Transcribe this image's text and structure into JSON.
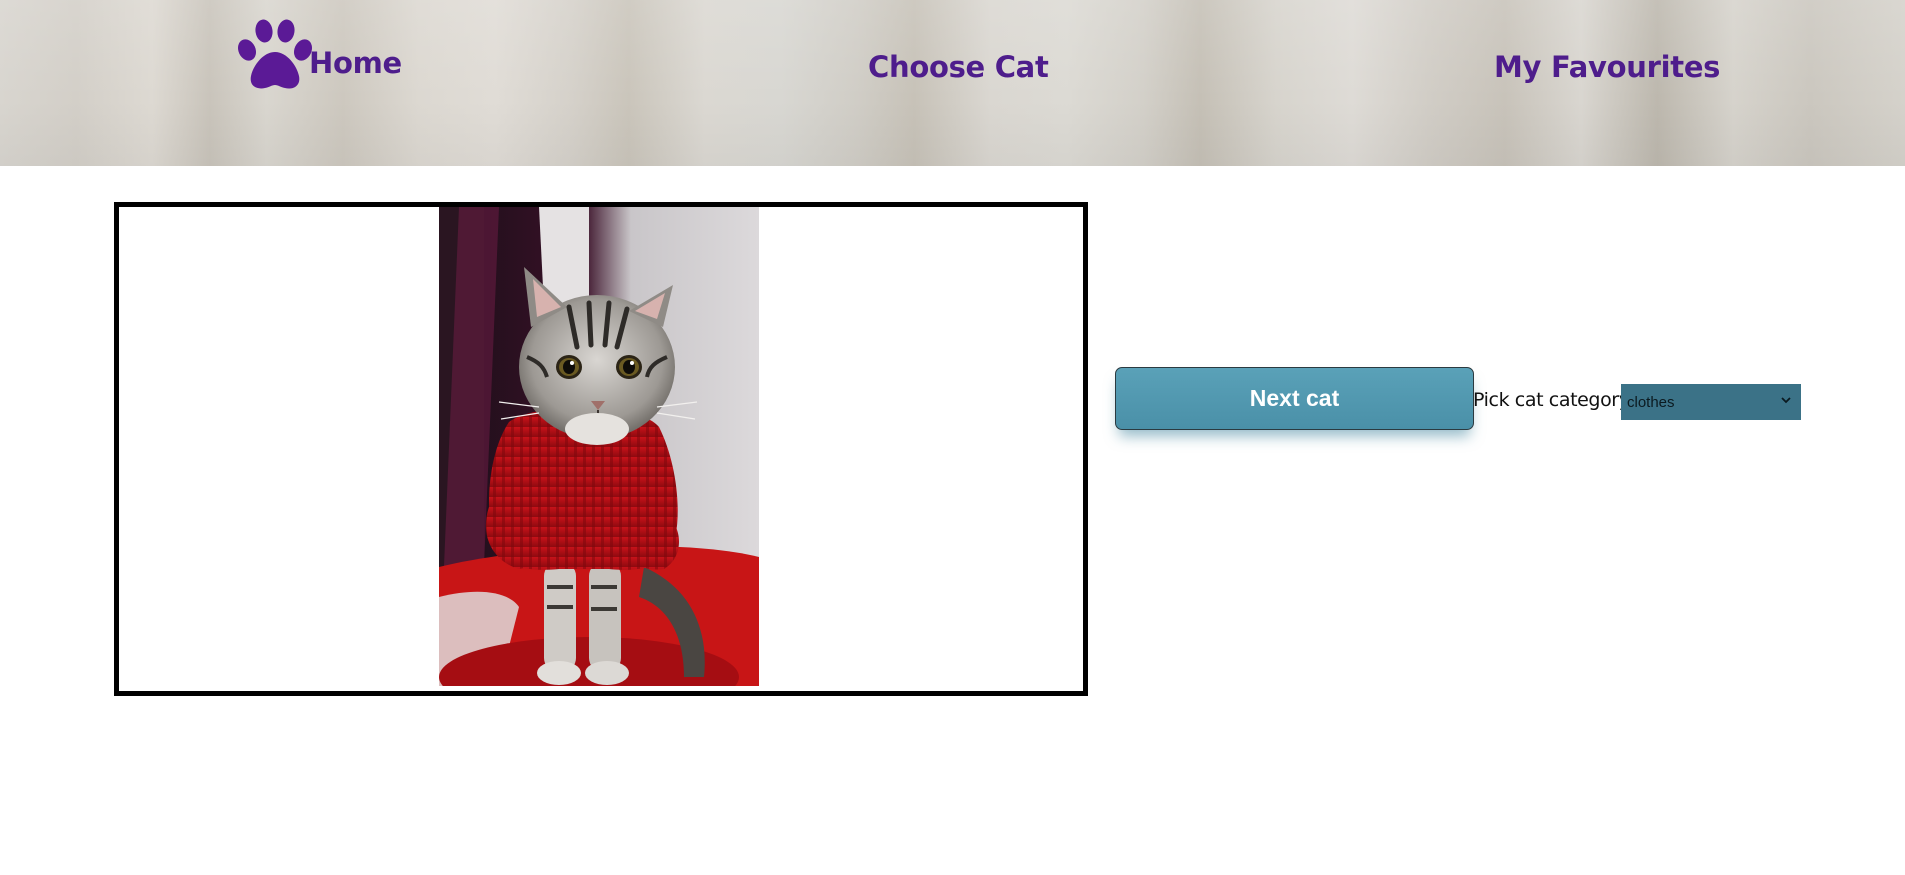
{
  "nav": {
    "home_label": "Home",
    "choose_label": "Choose Cat",
    "favourites_label": "My Favourites",
    "paw_icon": "paw-icon",
    "link_color": "#4e1d8c"
  },
  "main": {
    "photo_icon": "cat-in-red-sweater-photo",
    "next_button_label": "Next cat",
    "category_label": "Pick cat category:",
    "category_selected": "clothes",
    "button_color": "#4f96ad",
    "select_color": "#3b7287"
  }
}
